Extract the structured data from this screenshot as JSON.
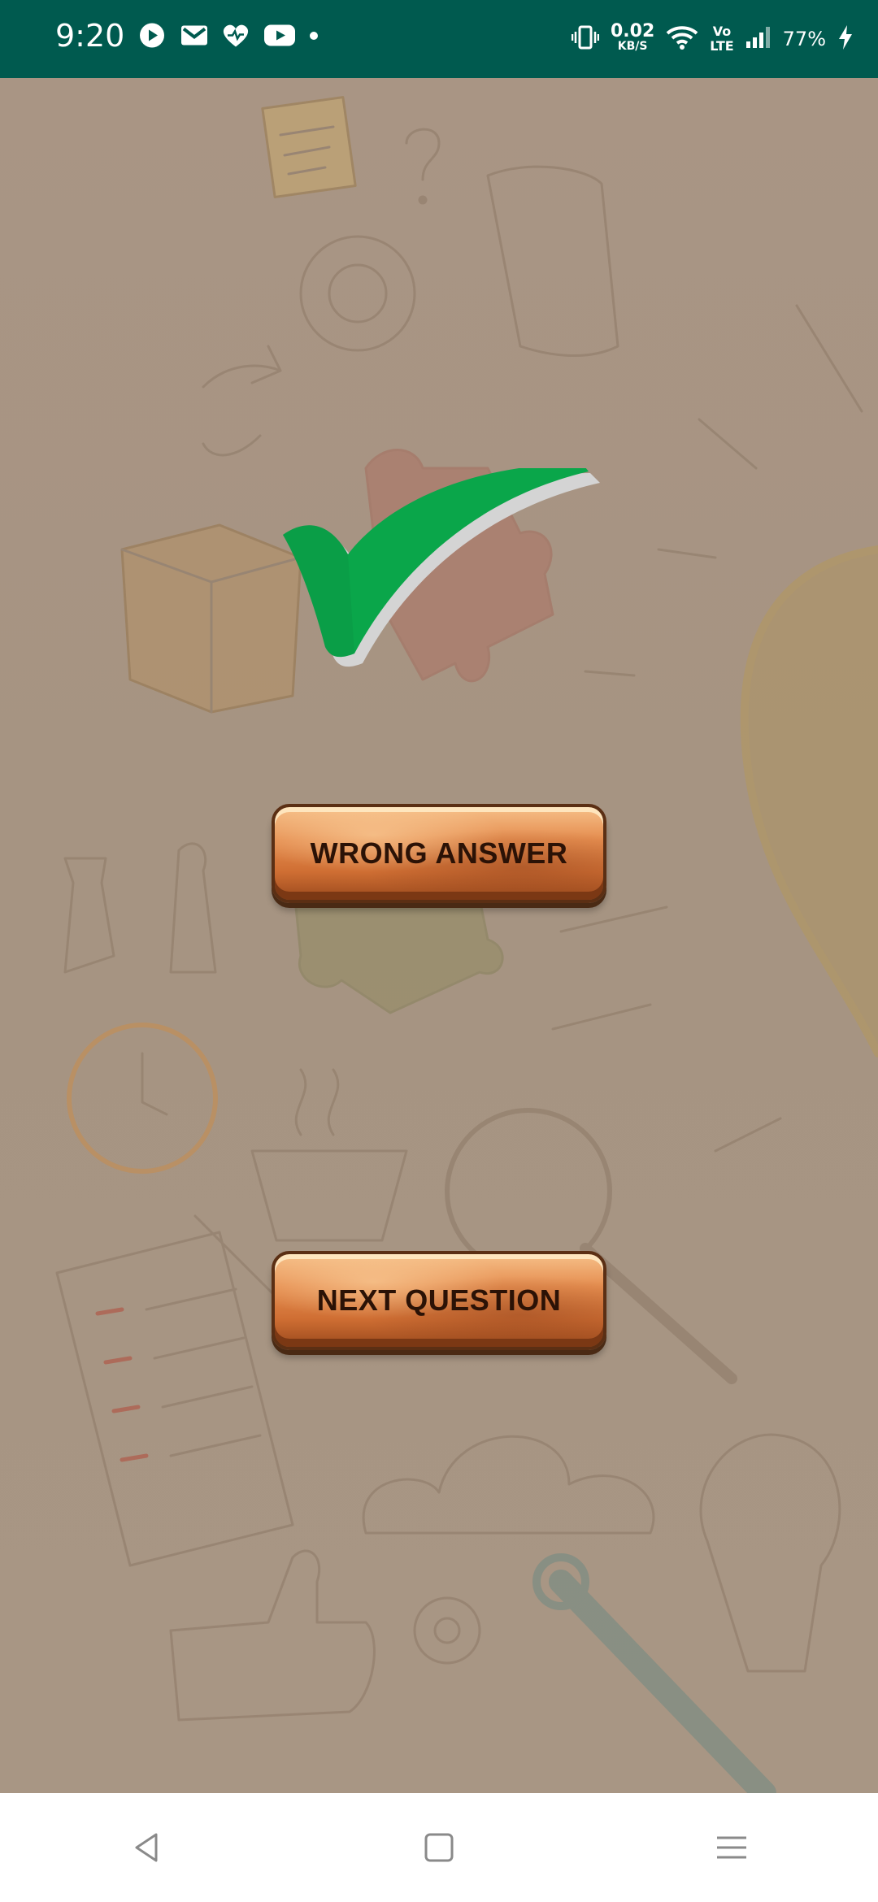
{
  "status_bar": {
    "time": "9:20",
    "net_speed_value": "0.02",
    "net_speed_unit": "KB/S",
    "volte_top": "Vo",
    "volte_bottom": "LTE",
    "battery": "77%",
    "notification_icons": [
      "play-circle-icon",
      "gmail-icon",
      "heart-icon",
      "youtube-icon",
      "dot-icon"
    ],
    "status_icons": [
      "vibrate-icon",
      "wifi-icon",
      "signal-icon",
      "charging-bolt-icon"
    ]
  },
  "result": {
    "icon": "checkmark-icon",
    "icon_color": "#0aa64a"
  },
  "buttons": {
    "wrong_answer": "WRONG ANSWER",
    "next_question": "NEXT QUESTION"
  },
  "nav_bar": {
    "items": [
      "back-icon",
      "home-icon",
      "recents-icon"
    ]
  },
  "colors": {
    "status_bar_bg": "#005a4f",
    "background": "#a89685",
    "button_wood": "#d9783a",
    "button_text": "#2b1206"
  }
}
